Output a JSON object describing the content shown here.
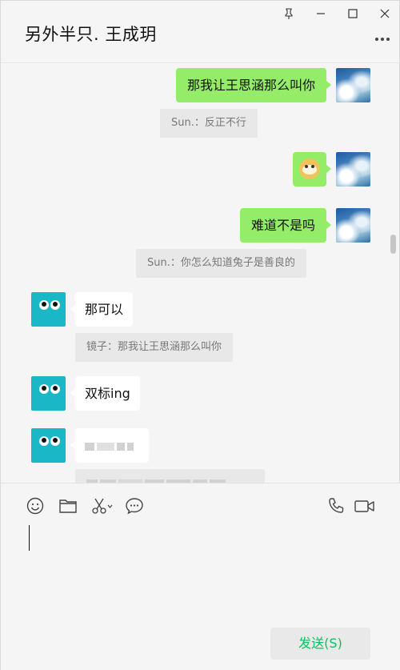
{
  "window": {
    "title": "另外半只. 王成玥",
    "controls": [
      "pin-icon",
      "minimize-icon",
      "maximize-icon",
      "close-icon"
    ],
    "more_icon": "more-dots-icon"
  },
  "messages": [
    {
      "side": "out",
      "text": "那我让王思涵那么叫你"
    },
    {
      "type": "quote",
      "text": "Sun.：反正不行"
    },
    {
      "side": "out",
      "type": "emoji",
      "emoji": "doge-emoji"
    },
    {
      "side": "out",
      "text": "难道不是吗"
    },
    {
      "type": "quote",
      "text": "Sun.：你怎么知道兔子是善良的"
    },
    {
      "side": "in",
      "text": "那可以"
    },
    {
      "type": "quote",
      "text": "镜子：那我让王思涵那么叫你"
    },
    {
      "side": "in",
      "text": "双标ing"
    },
    {
      "side": "in",
      "text": "",
      "redacted": true
    },
    {
      "type": "quote",
      "text": "",
      "redacted": true
    }
  ],
  "toolbar": {
    "left": [
      "emoji-icon",
      "folder-icon",
      "screenshot-icon",
      "chat-history-icon"
    ],
    "right": [
      "voice-call-icon",
      "video-call-icon"
    ]
  },
  "composer": {
    "input_value": "",
    "send_label": "发送(S)"
  },
  "colors": {
    "outgoing_bubble": "#95ec69",
    "incoming_bubble": "#ffffff",
    "quote_bg": "#e8e8e8",
    "send_text": "#07c160",
    "bot_avatar": "#1ab8c6"
  }
}
